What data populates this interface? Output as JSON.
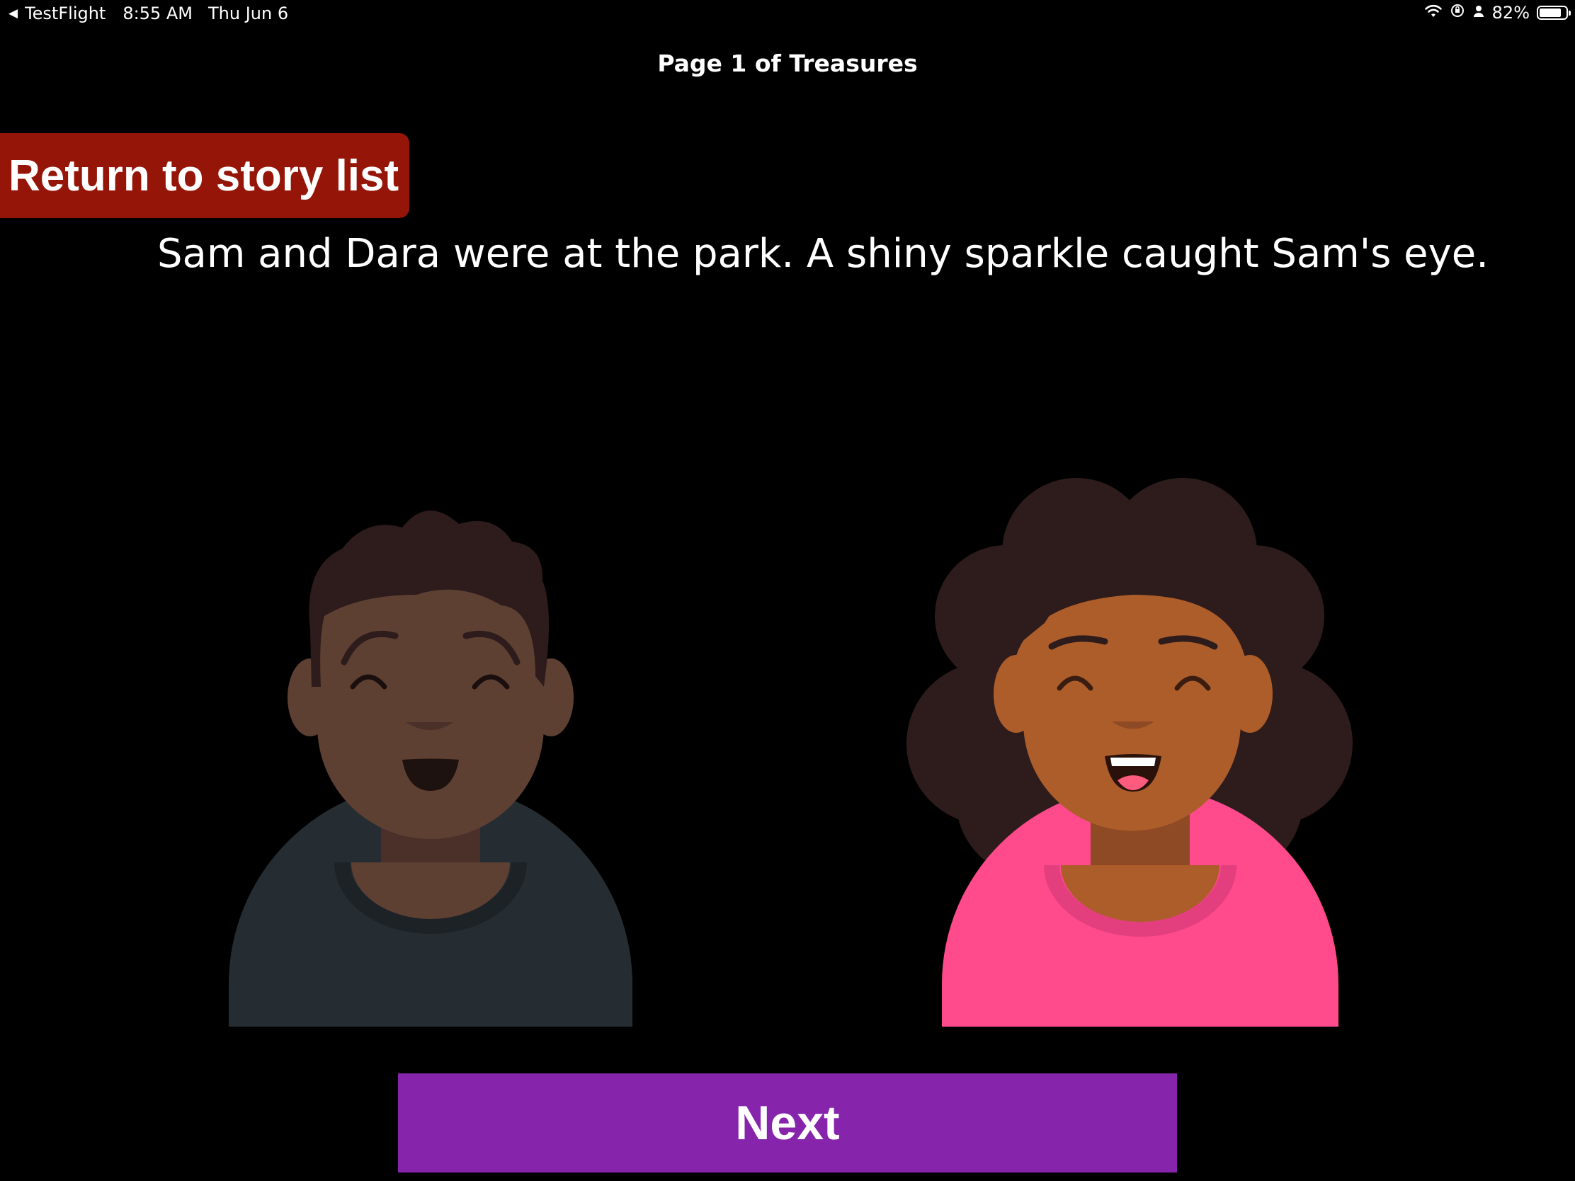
{
  "status_bar": {
    "back_arrow": "◀",
    "app": "TestFlight",
    "time": "8:55 AM",
    "date": "Thu Jun 6",
    "battery_percent": "82%",
    "battery_level": 0.82,
    "icons": [
      "wifi-icon",
      "orientation-lock-icon",
      "person-icon",
      "battery-icon"
    ]
  },
  "header": {
    "title": "Page 1 of Treasures"
  },
  "return_button": {
    "label": "Return to story list",
    "color": "#951608"
  },
  "story": {
    "text": "Sam and Dara were at the park. A shiny sparkle caught Sam's eye."
  },
  "characters": [
    {
      "id": "sam",
      "skin": "#5e4033",
      "hair": "#2d1c1b",
      "shirt": "#262d32"
    },
    {
      "id": "dara",
      "skin": "#ad5d2a",
      "hair": "#2d1c1b",
      "shirt": "#ff4a8c"
    }
  ],
  "next_button": {
    "label": "Next",
    "color": "#8624ac"
  }
}
